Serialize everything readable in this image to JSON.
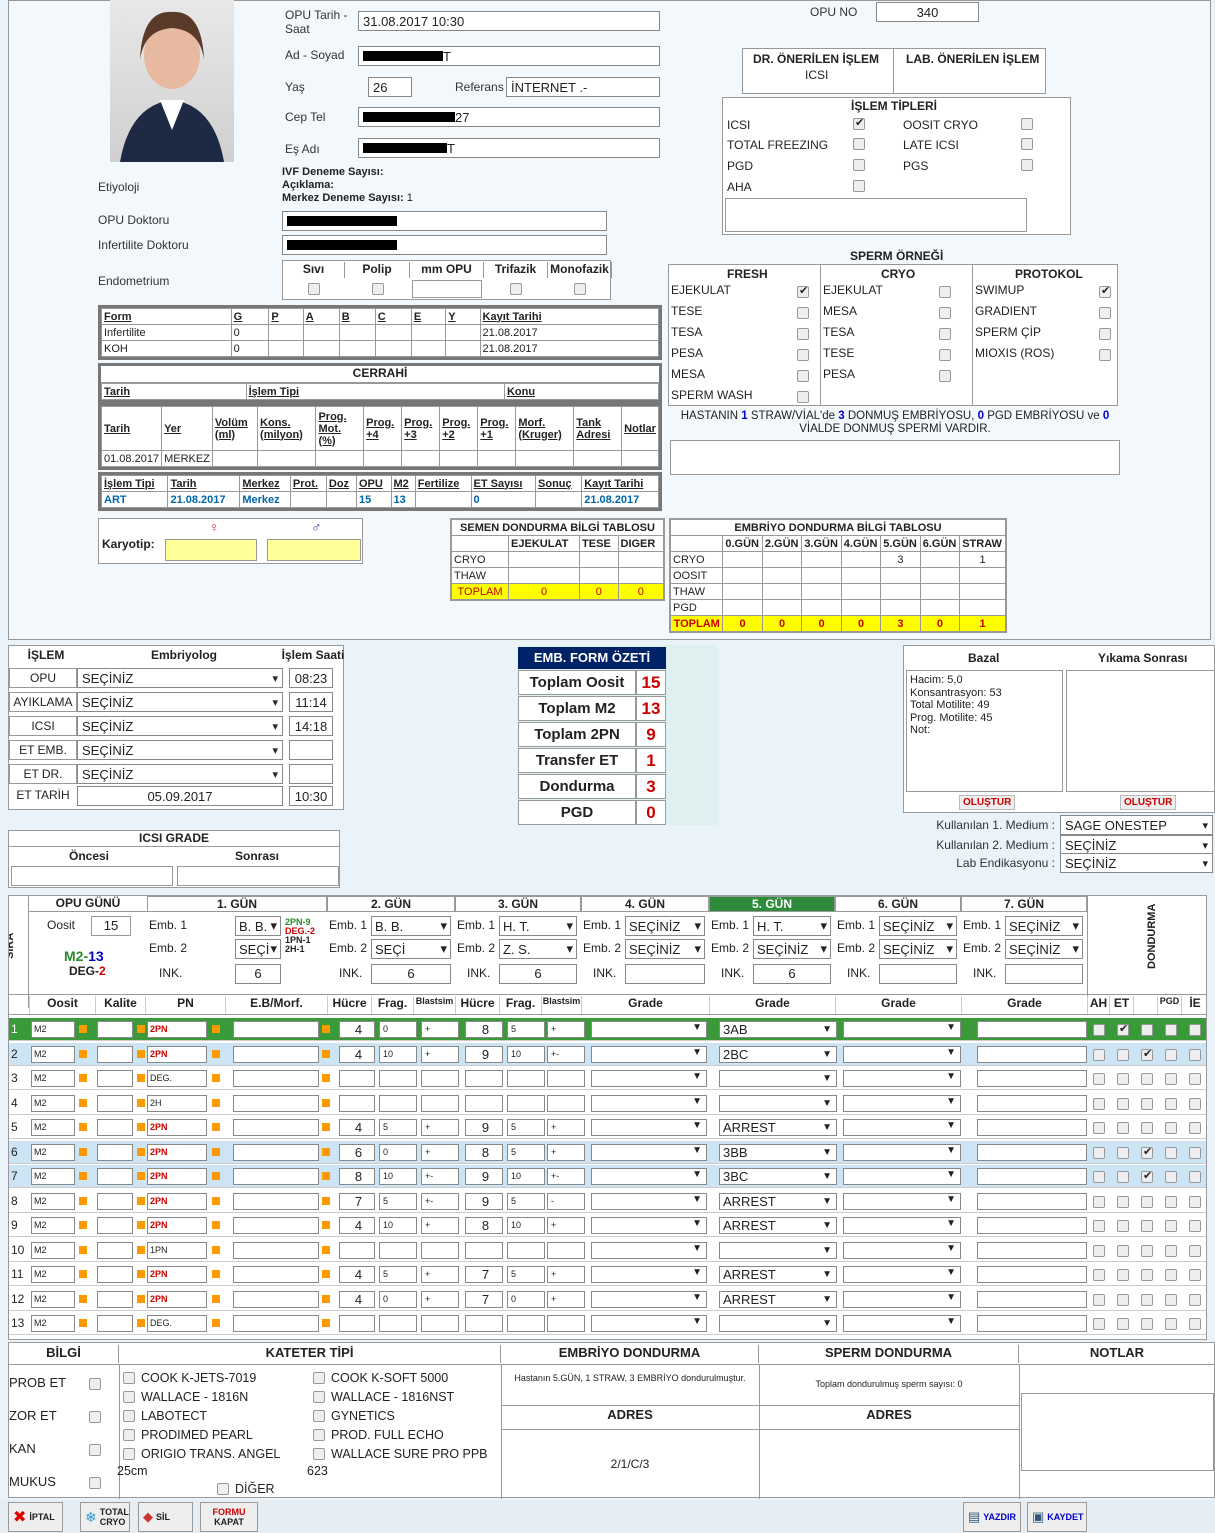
{
  "patient": {
    "opu_date_label": "OPU Tarih - Saat",
    "opu_date": "31.08.2017 10:30",
    "name_label": "Ad - Soyad",
    "name_tail": "T",
    "age_label": "Yaş",
    "age": "26",
    "ref_label": "Referans",
    "ref": "İNTERNET .-",
    "phone_label": "Cep Tel",
    "phone_tail": "27",
    "spouse_label": "Eş Adı",
    "spouse_tail": "T",
    "opu_no_label": "OPU NO",
    "opu_no": "340"
  },
  "info": {
    "etiology": "Etiyoloji",
    "ivf_trials": "IVF Deneme Sayısı:",
    "explanation": "Açıklama:",
    "center_trials": "Merkez Deneme Sayısı:",
    "center_trials_val": "1",
    "opu_doctor": "OPU Doktoru",
    "inf_doctor": "Infertilite Doktoru",
    "endometrium": "Endometrium",
    "endo_cols": [
      "Sıvı",
      "Polip",
      "mm OPU",
      "Trifazik",
      "Monofazik"
    ]
  },
  "recommend": {
    "dr": "DR. ÖNERİLEN İŞLEM",
    "lab": "LAB. ÖNERİLEN İŞLEM",
    "dr_val": "ICSI"
  },
  "process_types": {
    "title": "İŞLEM TİPLERİ",
    "items": [
      {
        "l": "ICSI",
        "on": true
      },
      {
        "l": "OOSIT CRYO",
        "on": false
      },
      {
        "l": "TOTAL FREEZING",
        "on": false
      },
      {
        "l": "LATE ICSI",
        "on": false
      },
      {
        "l": "PGD",
        "on": false
      },
      {
        "l": "PGS",
        "on": false
      },
      {
        "l": "AHA",
        "on": false
      }
    ]
  },
  "sperm": {
    "title": "SPERM ÖRNEĞİ",
    "fresh": "FRESH",
    "cryo": "CRYO",
    "protocol": "PROTOKOL",
    "fresh_items": [
      {
        "l": "EJEKULAT",
        "on": true
      },
      {
        "l": "TESE",
        "on": false
      },
      {
        "l": "TESA",
        "on": false
      },
      {
        "l": "PESA",
        "on": false
      },
      {
        "l": "MESA",
        "on": false
      },
      {
        "l": "SPERM WASH",
        "on": false
      }
    ],
    "cryo_items": [
      {
        "l": "EJEKULAT",
        "on": false
      },
      {
        "l": "MESA",
        "on": false
      },
      {
        "l": "TESA",
        "on": false
      },
      {
        "l": "TESE",
        "on": false
      },
      {
        "l": "PESA",
        "on": false
      }
    ],
    "protocol_items": [
      {
        "l": "SWIMUP",
        "on": true
      },
      {
        "l": "GRADIENT",
        "on": false
      },
      {
        "l": "SPERM ÇİP",
        "on": false
      },
      {
        "l": "MIOXIS (ROS)",
        "on": false
      }
    ],
    "note_a": "HASTANIN",
    "n1": "1",
    "note_b": "STRAW/VİAL'de",
    "n2": "3",
    "note_c": "DONMUŞ EMBRİYOSU,",
    "n3": "0",
    "note_d": "PGD EMBRİYOSU ve",
    "n4": "0",
    "note_e": "VİALDE DONMUŞ SPERMİ VARDIR."
  },
  "hormone": {
    "headers": [
      "Form",
      "G",
      "P",
      "A",
      "B",
      "C",
      "E",
      "Y",
      "Kayıt Tarihi"
    ],
    "rows": [
      [
        "Infertilite",
        "0",
        "",
        "",
        "",
        "",
        "",
        "",
        "21.08.2017"
      ],
      [
        "KOH",
        "0",
        "",
        "",
        "",
        "",
        "",
        "",
        "21.08.2017"
      ]
    ]
  },
  "surgery": {
    "title": "CERRAHİ",
    "headers": [
      "Tarih",
      "İşlem Tipi",
      "Konu"
    ]
  },
  "semen_hist": {
    "headers": [
      "Tarih",
      "Yer",
      "Volüm (ml)",
      "Kons. (milyon)",
      "Prog. Mot. (%)",
      "Prog. +4",
      "Prog. +3",
      "Prog. +2",
      "Prog. +1",
      "Morf. (Kruger)",
      "Tank Adresi",
      "Notlar"
    ],
    "row": [
      "01.08.2017",
      "MERKEZ"
    ]
  },
  "art": {
    "headers": [
      "İşlem Tipi",
      "Tarih",
      "Merkez",
      "Prot.",
      "Doz",
      "OPU",
      "M2",
      "Fertilize",
      "ET Sayısı",
      "Sonuç",
      "Kayıt Tarihi"
    ],
    "row": [
      "ART",
      "21.08.2017",
      "Merkez",
      "",
      "",
      "15",
      "13",
      "",
      "0",
      "",
      "21.08.2017"
    ]
  },
  "karyotip": {
    "label": "Karyotip:",
    "f": "♀",
    "m": "♂"
  },
  "semen_freeze": {
    "title": "SEMEN DONDURMA BİLGİ TABLOSU",
    "cols": [
      "EJEKULAT",
      "TESE",
      "DIGER"
    ],
    "rows": [
      "CRYO",
      "THAW"
    ],
    "total": "TOPLAM",
    "totals": [
      "0",
      "0",
      "0"
    ]
  },
  "embryo_freeze": {
    "title": "EMBRİYO DONDURMA BİLGİ TABLOSU",
    "cols": [
      "0.GÜN",
      "2.GÜN",
      "3.GÜN",
      "4.GÜN",
      "5.GÜN",
      "6.GÜN",
      "STRAW"
    ],
    "rows": [
      {
        "l": "CRYO",
        "v": [
          "",
          "",
          "",
          "",
          "3",
          "",
          "1"
        ]
      },
      {
        "l": "OOSIT",
        "v": [
          "",
          "",
          "",
          "",
          "",
          "",
          ""
        ]
      },
      {
        "l": "THAW",
        "v": [
          "",
          "",
          "",
          "",
          "",
          "",
          ""
        ]
      },
      {
        "l": "PGD",
        "v": [
          "",
          "",
          "",
          "",
          "",
          "",
          ""
        ]
      }
    ],
    "total": "TOPLAM",
    "totals": [
      "0",
      "0",
      "0",
      "0",
      "3",
      "0",
      "1"
    ]
  },
  "ops": {
    "h": [
      "İŞLEM",
      "Embriyolog",
      "İşlem Saati"
    ],
    "rows": [
      {
        "l": "OPU",
        "s": "SEÇİNİZ",
        "t": "08:23"
      },
      {
        "l": "AYIKLAMA",
        "s": "SEÇİNİZ",
        "t": "11:14"
      },
      {
        "l": "ICSI",
        "s": "SEÇİNİZ",
        "t": "14:18"
      },
      {
        "l": "ET EMB.",
        "s": "SEÇİNİZ",
        "t": ""
      },
      {
        "l": "ET DR.",
        "s": "SEÇİNİZ",
        "t": ""
      }
    ],
    "et_label": "ET TARİH",
    "et_date": "05.09.2017",
    "et_time": "10:30"
  },
  "icsi_grade": {
    "title": "ICSI GRADE",
    "before": "Öncesi",
    "after": "Sonrası"
  },
  "summary": {
    "title": "EMB. FORM ÖZETİ",
    "rows": [
      {
        "l": "Toplam Oosit",
        "v": "15"
      },
      {
        "l": "Toplam M2",
        "v": "13"
      },
      {
        "l": "Toplam 2PN",
        "v": "9"
      },
      {
        "l": "Transfer ET",
        "v": "1"
      },
      {
        "l": "Dondurma",
        "v": "3"
      },
      {
        "l": "PGD",
        "v": "0"
      }
    ]
  },
  "bazal": {
    "h1": "Bazal",
    "h2": "Yıkama Sonrası",
    "lines": [
      "Hacim: 5,0",
      "Konsantrasyon: 53",
      "Total Motilite: 49",
      "Prog. Motilite: 45",
      "Not:"
    ],
    "btn": "OLUŞTUR",
    "m1_label": "Kullanılan 1. Medium :",
    "m1": "SAGE ONESTEP",
    "m2_label": "Kullanılan 2. Medium :",
    "m2": "SEÇİNİZ",
    "lab_label": "Lab Endikasyonu :",
    "lab": "SEÇİNİZ"
  },
  "grid": {
    "sira": "SIRA",
    "opu_day": "OPU GÜNÜ",
    "oosit": "Oosit",
    "oosit_n": "15",
    "m2": "M2-",
    "m2n": "13",
    "deg": "DEG-",
    "degn": "2",
    "days": [
      "1. GÜN",
      "2. GÜN",
      "3. GÜN",
      "4. GÜN",
      "5. GÜN",
      "6. GÜN",
      "7. GÜN"
    ],
    "emb1": "Emb. 1",
    "emb2": "Emb. 2",
    "ink": "INK.",
    "d1": [
      "B. B.",
      "SEÇİ",
      "6"
    ],
    "d2": [
      "B. B.",
      "SEÇİ",
      "6"
    ],
    "d3": [
      "H. T.",
      "Z. S.",
      "6"
    ],
    "d4": [
      "SEÇİNİZ",
      "SEÇİNİZ",
      ""
    ],
    "d5": [
      "H. T.",
      "SEÇİNİZ",
      "6"
    ],
    "d6": [
      "SEÇİNİZ",
      "SEÇİNİZ",
      ""
    ],
    "d7": [
      "SEÇİNİZ",
      "SEÇİNİZ",
      ""
    ],
    "pn_summary": [
      "2PN-9",
      "DEG.-2",
      "1PN-1",
      "2H-1"
    ],
    "dondurma": "DONDURMA",
    "cols": [
      "Oosit",
      "Kalite",
      "PN",
      "E.B/Morf.",
      "Hücre",
      "Frag.",
      "Blastsim",
      "Hücre",
      "Frag.",
      "Blastsim",
      "Grade",
      "Grade",
      "Grade",
      "Grade",
      "AH",
      "ET",
      "",
      "PGD",
      "İE"
    ],
    "rows": [
      {
        "n": "1",
        "o": "M2",
        "pn": "2PN",
        "h2": "4",
        "f2": "0",
        "b2": "+",
        "h3": "8",
        "f3": "5",
        "b3": "+",
        "g5": "3AB",
        "c": [
          false,
          true,
          false,
          false,
          false
        ],
        "hl": "green"
      },
      {
        "n": "2",
        "o": "M2",
        "pn": "2PN",
        "h2": "4",
        "f2": "10",
        "b2": "+",
        "h3": "9",
        "f3": "10",
        "b3": "+-",
        "g5": "2BC",
        "c": [
          false,
          false,
          true,
          false,
          false
        ],
        "hl": "blue"
      },
      {
        "n": "3",
        "o": "M2",
        "pn": "DEG.",
        "h2": "",
        "f2": "",
        "b2": "",
        "h3": "",
        "f3": "",
        "b3": "",
        "g5": "",
        "c": [
          false,
          false,
          false,
          false,
          false
        ]
      },
      {
        "n": "4",
        "o": "M2",
        "pn": "2H",
        "h2": "",
        "f2": "",
        "b2": "",
        "h3": "",
        "f3": "",
        "b3": "",
        "g5": "",
        "c": [
          false,
          false,
          false,
          false,
          false
        ]
      },
      {
        "n": "5",
        "o": "M2",
        "pn": "2PN",
        "h2": "4",
        "f2": "5",
        "b2": "+",
        "h3": "9",
        "f3": "5",
        "b3": "+",
        "g5": "ARREST",
        "c": [
          false,
          false,
          false,
          false,
          false
        ]
      },
      {
        "n": "6",
        "o": "M2",
        "pn": "2PN",
        "h2": "6",
        "f2": "0",
        "b2": "+",
        "h3": "8",
        "f3": "5",
        "b3": "+",
        "g5": "3BB",
        "c": [
          false,
          false,
          true,
          false,
          false
        ],
        "hl": "blue"
      },
      {
        "n": "7",
        "o": "M2",
        "pn": "2PN",
        "h2": "8",
        "f2": "10",
        "b2": "+-",
        "h3": "9",
        "f3": "10",
        "b3": "+-",
        "g5": "3BC",
        "c": [
          false,
          false,
          true,
          false,
          false
        ],
        "hl": "blue"
      },
      {
        "n": "8",
        "o": "M2",
        "pn": "2PN",
        "h2": "7",
        "f2": "5",
        "b2": "+-",
        "h3": "9",
        "f3": "5",
        "b3": "-",
        "g5": "ARREST",
        "c": [
          false,
          false,
          false,
          false,
          false
        ]
      },
      {
        "n": "9",
        "o": "M2",
        "pn": "2PN",
        "h2": "4",
        "f2": "10",
        "b2": "+",
        "h3": "8",
        "f3": "10",
        "b3": "+",
        "g5": "ARREST",
        "c": [
          false,
          false,
          false,
          false,
          false
        ]
      },
      {
        "n": "10",
        "o": "M2",
        "pn": "1PN",
        "h2": "",
        "f2": "",
        "b2": "",
        "h3": "",
        "f3": "",
        "b3": "",
        "g5": "",
        "c": [
          false,
          false,
          false,
          false,
          false
        ]
      },
      {
        "n": "11",
        "o": "M2",
        "pn": "2PN",
        "h2": "4",
        "f2": "5",
        "b2": "+",
        "h3": "7",
        "f3": "5",
        "b3": "+",
        "g5": "ARREST",
        "c": [
          false,
          false,
          false,
          false,
          false
        ]
      },
      {
        "n": "12",
        "o": "M2",
        "pn": "2PN",
        "h2": "4",
        "f2": "0",
        "b2": "+",
        "h3": "7",
        "f3": "0",
        "b3": "+",
        "g5": "ARREST",
        "c": [
          false,
          false,
          false,
          false,
          false
        ]
      },
      {
        "n": "13",
        "o": "M2",
        "pn": "DEG.",
        "h2": "",
        "f2": "",
        "b2": "",
        "h3": "",
        "f3": "",
        "b3": "",
        "g5": "",
        "c": [
          false,
          false,
          false,
          false,
          false
        ]
      }
    ]
  },
  "bottom": {
    "bilgi": "BİLGİ",
    "bilgi_items": [
      "PROB ET",
      "ZOR ET",
      "KAN",
      "MUKUS"
    ],
    "kateter": "KATETER TİPİ",
    "kat_left": [
      "COOK K-JETS-7019",
      "WALLACE - 1816N",
      "LABOTECT",
      "PRODIMED PEARL",
      "ORIGIO TRANS. ANGEL"
    ],
    "kat_left_extra": "25cm",
    "kat_right": [
      "COOK K-SOFT 5000",
      "WALLACE - 1816NST",
      "GYNETICS",
      "PROD. FULL ECHO",
      "WALLACE SURE PRO PPB"
    ],
    "kat_right_extra": "623",
    "diger": "DİĞER",
    "emb_d": "EMBRİYO DONDURMA",
    "emb_d_text": "Hastanın 5.GÜN, 1 STRAW, 3 EMBRİYO dondurulmuştur.",
    "adres": "ADRES",
    "adres_val": "2/1/C/3",
    "sperm_d": "SPERM DONDURMA",
    "sperm_d_text": "Toplam dondurulmuş sperm sayısı: 0",
    "notlar": "NOTLAR"
  },
  "footer": {
    "iptal": "İPTAL",
    "total": "TOTAL",
    "cryo": "CRYO",
    "sil": "SİL",
    "formu": "FORMU",
    "kapat": "KAPAT",
    "yazdir": "YAZDIR",
    "kaydet": "KAYDET"
  }
}
